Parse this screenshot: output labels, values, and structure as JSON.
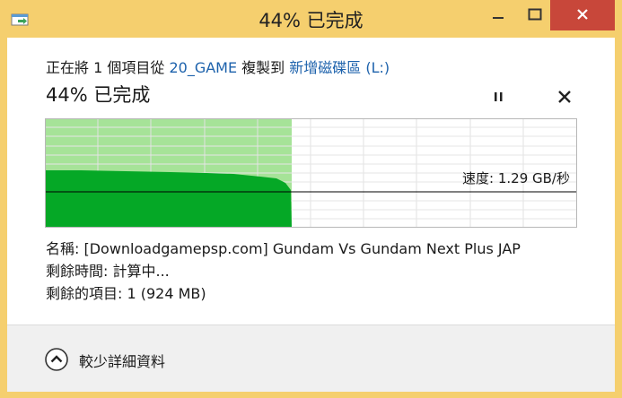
{
  "window": {
    "title": "44% 已完成",
    "controls": [
      "minimize-icon",
      "maximize-icon",
      "close-icon"
    ]
  },
  "copy": {
    "prefix": "正在將 1 個項目從",
    "source": "20_GAME",
    "middle": "複製到",
    "destination": "新增磁碟區 (L:)"
  },
  "progress": {
    "heading": "44% 已完成",
    "percent": 44,
    "speed_label": "速度: 1.29 GB/秒"
  },
  "details": {
    "name_row": "名稱:  [Downloadgamepsp.com] Gundam Vs Gundam Next Plus JAP",
    "time_row": "剩餘時間:  計算中...",
    "items_row": "剩餘的項目:  1 (924 MB)"
  },
  "footer": {
    "toggle_label": "較少詳細資料",
    "toggle_icon": "chevron-up-circle-icon"
  },
  "colors": {
    "title_bar": "#f5cf6e",
    "close_button": "#c8473a",
    "link": "#1d62ac",
    "progress_fill": "#a6e398",
    "speed_fill": "#05a826"
  }
}
